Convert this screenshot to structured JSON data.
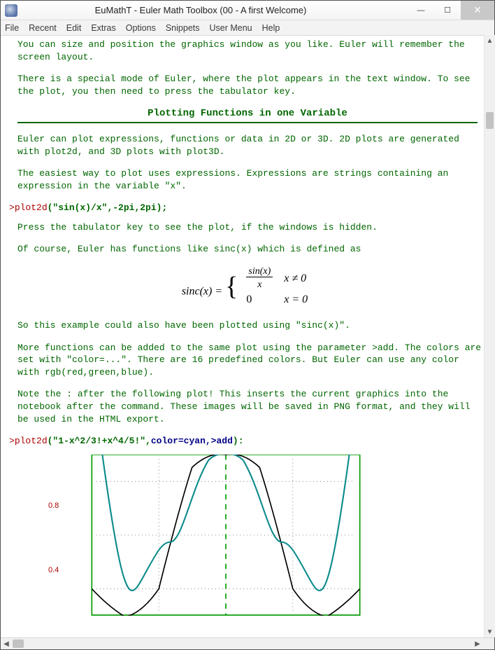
{
  "window": {
    "title": "EuMathT - Euler Math Toolbox (00 - A first Welcome)",
    "min": "—",
    "max": "☐",
    "close": "✕"
  },
  "menu": [
    "File",
    "Recent",
    "Edit",
    "Extras",
    "Options",
    "Snippets",
    "User Menu",
    "Help"
  ],
  "doc": {
    "p1": "You can size and position the graphics window as you like. Euler will remember the screen layout.",
    "p2": "There is a special mode of Euler, where the plot appears in the text window. To see the plot, you then need to press the tabulator key.",
    "section1": "Plotting Functions in one Variable",
    "p3": "Euler can plot expressions, functions or data in 2D or 3D. 2D plots are generated with plot2d, and 3D plots with plot3D.",
    "p4": "The easiest way to plot uses expressions. Expressions are strings containing an expression in the variable \"x\".",
    "cmd1_prompt": ">",
    "cmd1_fn": "plot2d",
    "cmd1_args": "(\"sin(x)/x\",-2pi,2pi);",
    "p5": "Press the tabulator key to see the plot, if the windows is hidden.",
    "p6": "Of course, Euler has functions like sinc(x) which is defined as",
    "formula_lhs": "sinc(x) =",
    "formula_r1a": "sin(x)",
    "formula_r1b": "x",
    "formula_r1c": "x ≠ 0",
    "formula_r2a": "0",
    "formula_r2c": "x = 0",
    "p7": "So this example could also have been plotted using \"sinc(x)\".",
    "p8": "More functions can be added to the same plot using the parameter >add. The colors are set with \"color=...\". There are 16 predefined colors. But Euler can use any color with rgb(red,green,blue).",
    "p9": "Note the : after the following plot! This inserts the current graphics into the notebook after the command. These images will be saved in PNG format, and they will be used in the HTML export.",
    "cmd2_prompt": ">",
    "cmd2_fn": "plot2d",
    "cmd2_args_a": "(\"1-x^2/3!+x^4/5!\",",
    "cmd2_args_b": "color=cyan,>add",
    "cmd2_args_c": "):"
  },
  "chart_data": {
    "type": "line",
    "title": "",
    "xlabel": "",
    "ylabel": "",
    "xlim": [
      -6.28,
      6.28
    ],
    "ylim": [
      -0.2,
      1.0
    ],
    "yticks": [
      0.4,
      0.8
    ],
    "grid": "dotted",
    "series": [
      {
        "name": "sin(x)/x",
        "color": "#000000",
        "x": [
          -6.28,
          -5.5,
          -4.71,
          -3.93,
          -3.14,
          -2.36,
          -1.57,
          -0.79,
          0,
          0.79,
          1.57,
          2.36,
          3.14,
          3.93,
          4.71,
          5.5,
          6.28
        ],
        "y": [
          0.0,
          -0.13,
          -0.21,
          -0.18,
          0.0,
          0.3,
          0.64,
          0.9,
          1.0,
          0.9,
          0.64,
          0.3,
          0.0,
          -0.18,
          -0.21,
          -0.13,
          0.0
        ]
      },
      {
        "name": "1-x^2/3!+x^4/5!",
        "color": "#008888",
        "x": [
          -6.28,
          -5.5,
          -4.71,
          -3.93,
          -3.14,
          -2.36,
          -1.57,
          -0.79,
          0,
          0.79,
          1.57,
          2.36,
          3.14,
          3.93,
          4.71,
          5.5,
          6.28
        ],
        "y": [
          7.4,
          3.64,
          1.42,
          0.38,
          0.18,
          0.33,
          0.64,
          0.9,
          1.0,
          0.9,
          0.64,
          0.33,
          0.18,
          0.38,
          1.42,
          3.64,
          7.4
        ]
      }
    ]
  }
}
